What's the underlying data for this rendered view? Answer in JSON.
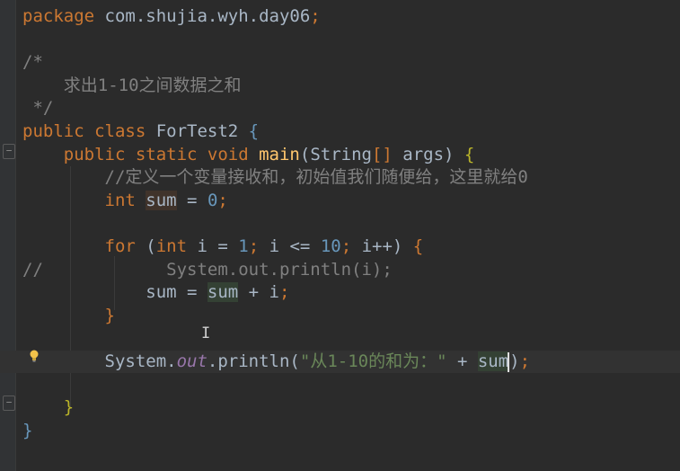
{
  "editor": {
    "language": "java",
    "lines": [
      {
        "id": "l1",
        "parts": [
          [
            "kw",
            "package"
          ],
          [
            "pkg",
            " com.shujia.wyh.day06"
          ],
          [
            "kw",
            ";"
          ]
        ]
      },
      {
        "id": "l2",
        "parts": []
      },
      {
        "id": "l3",
        "parts": [
          [
            "cmt",
            "/*"
          ]
        ]
      },
      {
        "id": "l4",
        "parts": [
          [
            "cmt",
            "    求出1-10之间数据之和"
          ]
        ]
      },
      {
        "id": "l5",
        "parts": [
          [
            "cmt",
            " */"
          ]
        ]
      },
      {
        "id": "l6",
        "parts": [
          [
            "kw",
            "public class "
          ],
          [
            "pkg",
            "ForTest2 "
          ],
          [
            "brace-blue",
            "{"
          ]
        ]
      },
      {
        "id": "l7",
        "parts": [
          [
            "kw",
            "    public static void "
          ],
          [
            "fn",
            "main"
          ],
          [
            "pkg",
            "(String"
          ],
          [
            "kw",
            "[] "
          ],
          [
            "pkg",
            "args) "
          ],
          [
            "brace-yellow",
            "{"
          ]
        ]
      },
      {
        "id": "l8",
        "parts": [
          [
            "cmt",
            "        //定义一个变量接收和，初始值我们随便给，这里就给0"
          ]
        ]
      },
      {
        "id": "l9",
        "parts": [
          [
            "kw",
            "        int "
          ],
          [
            "hl-var2",
            "sum"
          ],
          [
            "pkg",
            " = "
          ],
          [
            "num",
            "0"
          ],
          [
            "kw",
            ";"
          ]
        ]
      },
      {
        "id": "l10",
        "parts": []
      },
      {
        "id": "l11",
        "parts": [
          [
            "kw",
            "        for "
          ],
          [
            "pkg",
            "("
          ],
          [
            "kw",
            "int "
          ],
          [
            "pkg",
            "i = "
          ],
          [
            "num",
            "1"
          ],
          [
            "kw",
            "; "
          ],
          [
            "pkg",
            "i <= "
          ],
          [
            "num",
            "10"
          ],
          [
            "kw",
            "; "
          ],
          [
            "pkg",
            "i++) "
          ],
          [
            "brace-olive",
            "{"
          ]
        ]
      },
      {
        "id": "l12",
        "parts": [
          [
            "cmt",
            "//            System.out.println(i);"
          ]
        ]
      },
      {
        "id": "l13",
        "parts": [
          [
            "pkg",
            "            sum = "
          ],
          [
            "hl-var",
            "sum"
          ],
          [
            "pkg",
            " + i"
          ],
          [
            "kw",
            ";"
          ]
        ]
      },
      {
        "id": "l14",
        "parts": [
          [
            "brace-olive",
            "        }"
          ]
        ]
      },
      {
        "id": "l15",
        "parts": []
      },
      {
        "id": "l16",
        "parts": [
          [
            "pkg",
            "        System."
          ],
          [
            "static-call",
            "out"
          ],
          [
            "pkg",
            ".println("
          ],
          [
            "str",
            "\"从1-10的和为：\" "
          ],
          [
            "pkg",
            "+ "
          ],
          [
            "hl-var",
            "sum"
          ],
          [
            "caret",
            ""
          ],
          [
            "pkg",
            ")"
          ],
          [
            "kw",
            ";"
          ]
        ]
      },
      {
        "id": "l17",
        "parts": []
      },
      {
        "id": "l18",
        "parts": [
          [
            "brace-yellow",
            "    }"
          ]
        ]
      },
      {
        "id": "l19",
        "parts": [
          [
            "brace-blue",
            "}"
          ]
        ]
      }
    ]
  },
  "icons": {
    "bulb": "lightbulb-icon",
    "ibeam": "text-cursor-icon",
    "ibeam_glyph": "I"
  }
}
